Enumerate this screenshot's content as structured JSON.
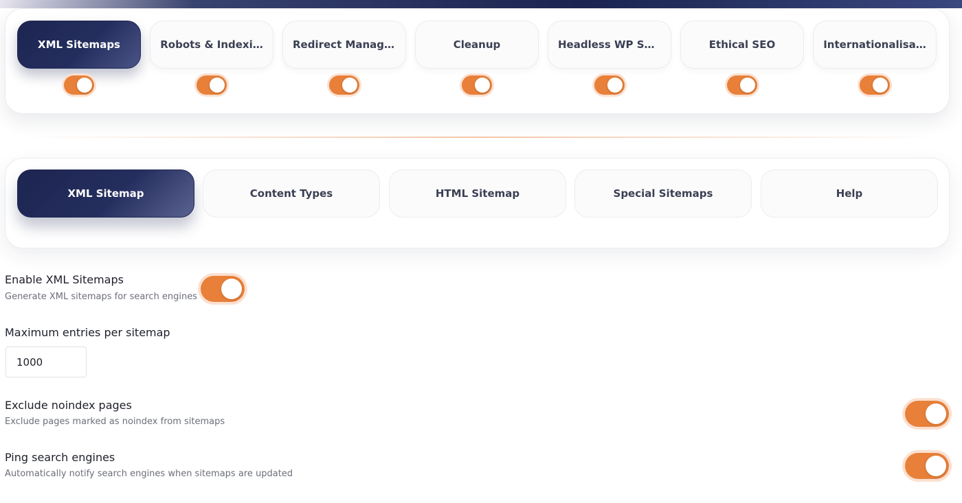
{
  "modules": [
    {
      "label": "XML Sitemaps",
      "enabled": true,
      "active": true
    },
    {
      "label": "Robots & Indexi…",
      "enabled": true,
      "active": false
    },
    {
      "label": "Redirect Manager",
      "enabled": true,
      "active": false
    },
    {
      "label": "Cleanup",
      "enabled": true,
      "active": false
    },
    {
      "label": "Headless WP Su…",
      "enabled": true,
      "active": false
    },
    {
      "label": "Ethical SEO",
      "enabled": true,
      "active": false
    },
    {
      "label": "Internationalisa…",
      "enabled": true,
      "active": false
    }
  ],
  "tabs": [
    {
      "label": "XML Sitemap",
      "active": true
    },
    {
      "label": "Content Types",
      "active": false
    },
    {
      "label": "HTML Sitemap",
      "active": false
    },
    {
      "label": "Special Sitemaps",
      "active": false
    },
    {
      "label": "Help",
      "active": false
    }
  ],
  "settings": {
    "enable_xml": {
      "title": "Enable XML Sitemaps",
      "desc": "Generate XML sitemaps for search engines",
      "enabled": true
    },
    "max_entries": {
      "title": "Maximum entries per sitemap",
      "value": "1000"
    },
    "exclude_noindex": {
      "title": "Exclude noindex pages",
      "desc": "Exclude pages marked as noindex from sitemaps",
      "enabled": true
    },
    "ping": {
      "title": "Ping search engines",
      "desc": "Automatically notify search engines when sitemaps are updated",
      "enabled": true
    }
  },
  "colors": {
    "accent": "#e8803a",
    "navy": "#1d2550"
  }
}
